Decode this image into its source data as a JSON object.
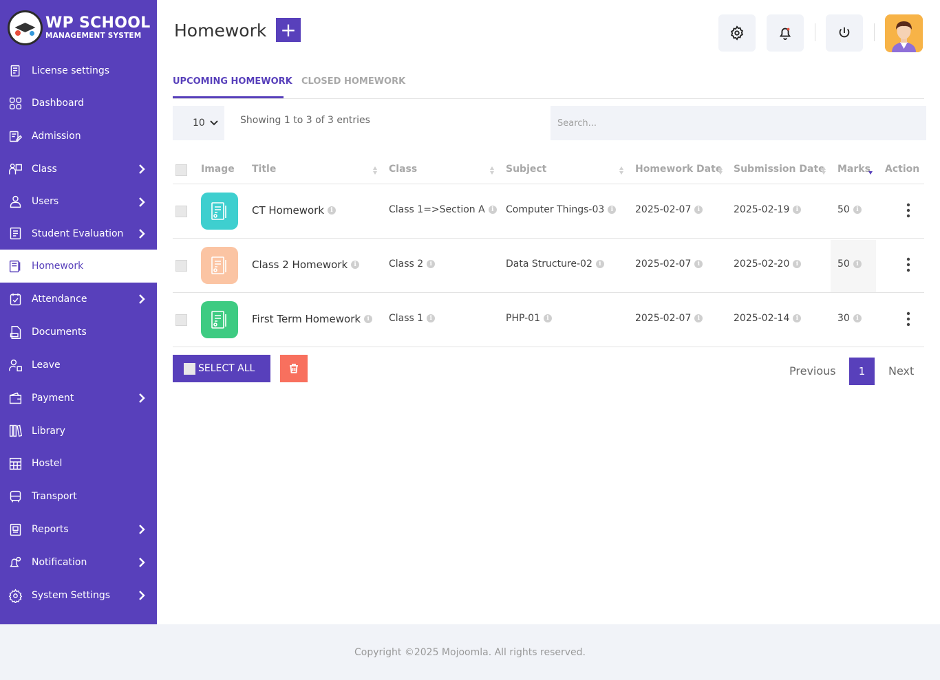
{
  "app": {
    "logo_title": "WP SCHOOL",
    "logo_subtitle": "MANAGEMENT SYSTEM"
  },
  "sidebar": {
    "items": [
      {
        "label": "License settings",
        "icon": "license-icon",
        "has_submenu": false
      },
      {
        "label": "Dashboard",
        "icon": "dashboard-icon",
        "has_submenu": false
      },
      {
        "label": "Admission",
        "icon": "admission-icon",
        "has_submenu": false
      },
      {
        "label": "Class",
        "icon": "class-icon",
        "has_submenu": true
      },
      {
        "label": "Users",
        "icon": "user-icon",
        "has_submenu": true
      },
      {
        "label": "Student Evaluation",
        "icon": "evaluation-icon",
        "has_submenu": true
      },
      {
        "label": "Homework",
        "icon": "homework-icon",
        "has_submenu": false,
        "active": true
      },
      {
        "label": "Attendance",
        "icon": "attendance-icon",
        "has_submenu": true
      },
      {
        "label": "Documents",
        "icon": "document-icon",
        "has_submenu": false
      },
      {
        "label": "Leave",
        "icon": "leave-icon",
        "has_submenu": false
      },
      {
        "label": "Payment",
        "icon": "wallet-icon",
        "has_submenu": true
      },
      {
        "label": "Library",
        "icon": "library-icon",
        "has_submenu": false
      },
      {
        "label": "Hostel",
        "icon": "hostel-icon",
        "has_submenu": false
      },
      {
        "label": "Transport",
        "icon": "bus-icon",
        "has_submenu": false
      },
      {
        "label": "Reports",
        "icon": "report-icon",
        "has_submenu": true
      },
      {
        "label": "Notification",
        "icon": "notification-icon",
        "has_submenu": true
      },
      {
        "label": "System Settings",
        "icon": "gear-icon",
        "has_submenu": true
      }
    ]
  },
  "header": {
    "title": "Homework",
    "add_label": "+"
  },
  "tabs": [
    {
      "label": "UPCOMING HOMEWORK",
      "active": true
    },
    {
      "label": "CLOSED HOMEWORK",
      "active": false
    }
  ],
  "controls": {
    "page_size": "10",
    "showing": "Showing 1 to 3 of 3 entries",
    "search_placeholder": "Search..."
  },
  "table": {
    "columns": [
      "Image",
      "Title",
      "Class",
      "Subject",
      "Homework Date",
      "Submission Date",
      "Marks",
      "Action"
    ],
    "rows": [
      {
        "title": "CT Homework",
        "class": "Class 1=>Section A",
        "subject": "Computer Things-03",
        "homework_date": "2025-02-07",
        "submission_date": "2025-02-19",
        "marks": "50",
        "thumb_color": "#3ecfcf"
      },
      {
        "title": "Class 2 Homework",
        "class": "Class 2",
        "subject": "Data Structure-02",
        "homework_date": "2025-02-07",
        "submission_date": "2025-02-20",
        "marks": "50",
        "thumb_color": "#fbc4a3"
      },
      {
        "title": "First Term Homework",
        "class": "Class 1",
        "subject": "PHP-01",
        "homework_date": "2025-02-07",
        "submission_date": "2025-02-14",
        "marks": "30",
        "thumb_color": "#3ecb82"
      }
    ]
  },
  "footer_buttons": {
    "select_all": "SELECT ALL"
  },
  "pagination": {
    "previous": "Previous",
    "current": "1",
    "next": "Next"
  },
  "footer": {
    "copyright": "Copyright ©2025 Mojoomla. All rights reserved."
  },
  "colors": {
    "primary": "#5840bb",
    "delete": "#f8705e"
  }
}
